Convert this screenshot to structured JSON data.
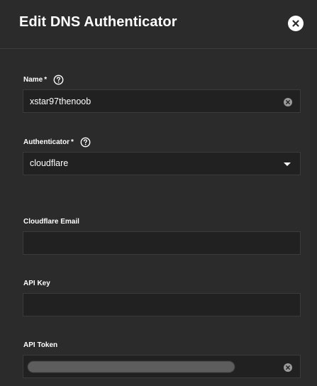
{
  "dialog": {
    "title": "Edit DNS Authenticator",
    "close_icon": "close-icon"
  },
  "fields": {
    "name": {
      "label": "Name",
      "required_mark": "*",
      "value": "xstar97thenoob"
    },
    "authenticator": {
      "label": "Authenticator",
      "required_mark": "*",
      "selected": "cloudflare"
    },
    "cloudflare_email": {
      "label": "Cloudflare Email",
      "value": ""
    },
    "api_key": {
      "label": "API Key",
      "value": ""
    },
    "api_token": {
      "label": "API Token",
      "value": ""
    }
  },
  "colors": {
    "background": "#2b2b2b",
    "input_background": "#212121",
    "text": "#ffffff"
  }
}
